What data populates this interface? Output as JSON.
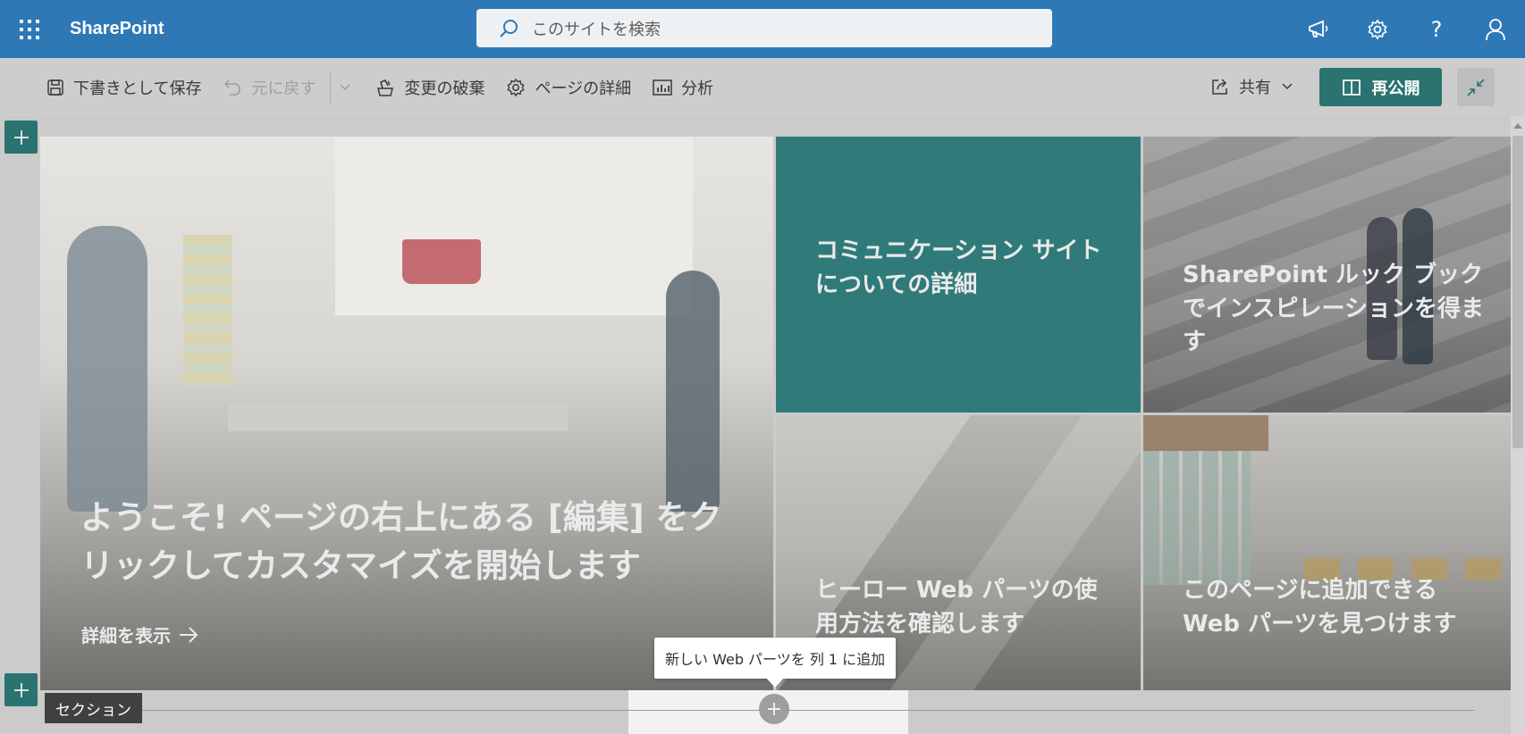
{
  "suitebar": {
    "brand": "SharePoint",
    "search_placeholder": "このサイトを検索",
    "icons": [
      "waffle-icon",
      "megaphone-icon",
      "gear-icon",
      "help-icon",
      "user-icon"
    ],
    "help_glyph": "?",
    "color": "#2f78b6"
  },
  "commandbar": {
    "save_draft": "下書きとして保存",
    "undo": "元に戻す",
    "discard": "変更の破棄",
    "page_details": "ページの詳細",
    "analytics": "分析",
    "share": "共有",
    "republish": "再公開"
  },
  "hero": {
    "main": {
      "title": "ようこそ! ページの右上にある [編集] をクリックしてカスタマイズを開始します",
      "more_link": "詳細を表示"
    },
    "tiles": [
      {
        "title": "コミュニケーション サイトについての詳細",
        "color": "#307b7a"
      },
      {
        "title": "SharePoint ルック ブックでインスピレーションを得ます"
      },
      {
        "title": "ヒーロー Web パーツの使用方法を確認します"
      },
      {
        "title": "このページに追加できる Web パーツを見つけます"
      }
    ]
  },
  "section": {
    "label": "セクション",
    "tooltip": "新しい Web パーツを 列 1 に追加"
  },
  "colors": {
    "accent": "#2a7370",
    "canvas": "#cbcbcb"
  }
}
